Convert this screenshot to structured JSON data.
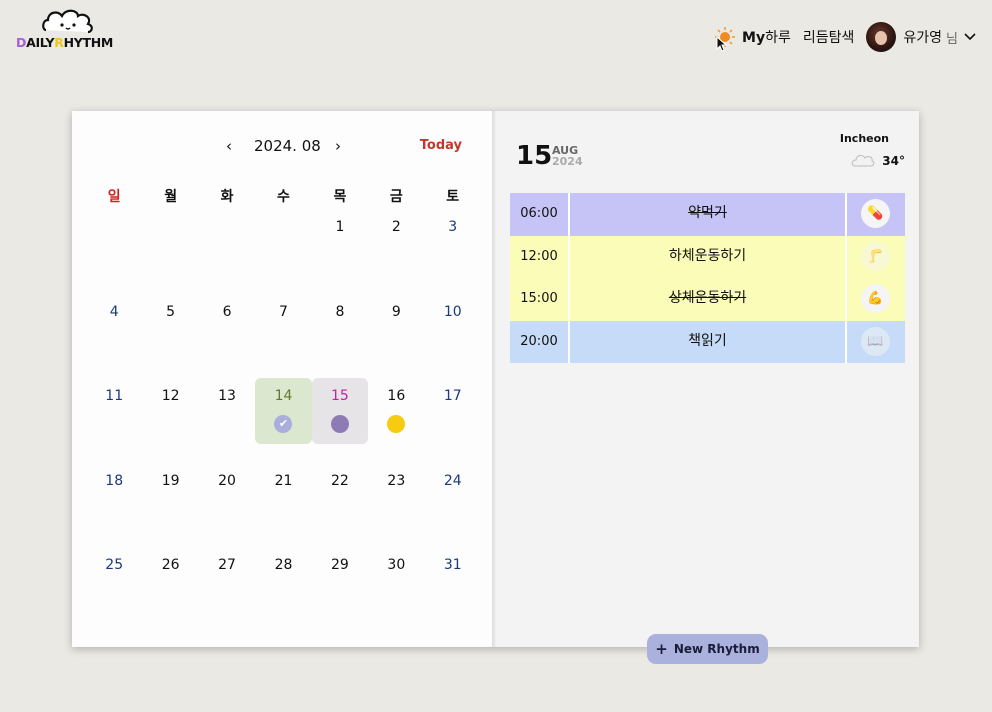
{
  "logo": {
    "text_d": "D",
    "text_aily": "AILY",
    "text_r": "R",
    "text_hythm": "HYTHM"
  },
  "nav": {
    "sun_icon": "sun-icon",
    "my_bold": "My",
    "my_rest": "하루",
    "search": "리듬탐색",
    "user": "유가영",
    "nim": "님",
    "chevron": "⌄"
  },
  "calendar": {
    "prev": "‹",
    "next": "›",
    "month": "2024. 08",
    "today": "Today",
    "weekdays": [
      "일",
      "월",
      "화",
      "수",
      "목",
      "금",
      "토"
    ],
    "weeks": [
      [
        "",
        "",
        "",
        "",
        "1",
        "2",
        "3"
      ],
      [
        "4",
        "5",
        "6",
        "7",
        "8",
        "9",
        "10"
      ],
      [
        "11",
        "12",
        "13",
        "14",
        "15",
        "16",
        "17"
      ],
      [
        "18",
        "19",
        "20",
        "21",
        "22",
        "23",
        "24"
      ],
      [
        "25",
        "26",
        "27",
        "28",
        "29",
        "30",
        "31"
      ]
    ]
  },
  "detail": {
    "day": "15",
    "month": "AUG",
    "year": "2024",
    "city": "Incheon",
    "temp": "34°",
    "tasks": [
      {
        "time": "06:00",
        "title": "약먹기",
        "icon": "💊",
        "done": true
      },
      {
        "time": "12:00",
        "title": "하체운동하기",
        "icon": "🦵",
        "done": false
      },
      {
        "time": "15:00",
        "title": "상체운동하기",
        "icon": "💪",
        "done": true
      },
      {
        "time": "20:00",
        "title": "책읽기",
        "icon": "📖",
        "done": false
      }
    ]
  },
  "new_rhythm": {
    "plus": "+",
    "label": "New Rhythm"
  },
  "colors": {
    "background": "#ebe9e4",
    "today": "#c0392b",
    "purple_task": "#c6c3f7",
    "yellow_task": "#fcfcb9",
    "blue_task": "#c5dbf7",
    "button": "#a9b1dc"
  }
}
